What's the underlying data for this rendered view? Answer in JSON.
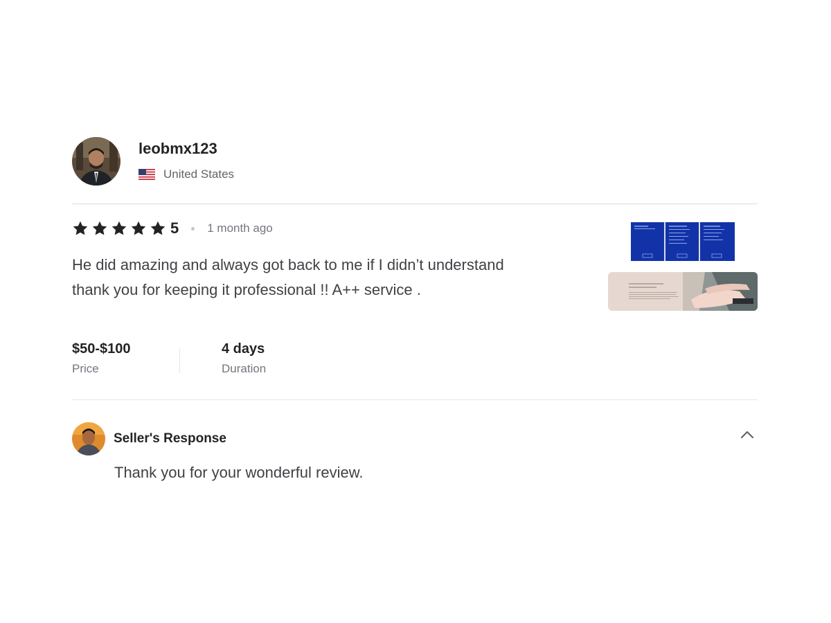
{
  "reviewer": {
    "username": "leobmx123",
    "country": "United States",
    "avatar_icon": "user-photo-avatar",
    "flag_icon": "us-flag-icon"
  },
  "review": {
    "rating": "5",
    "rating_stars": 5,
    "time_ago": "1 month ago",
    "text": "He did amazing and always got back to me if I didn’t understand thank you for keeping it professional !! A++ service .",
    "price": {
      "value": "$50-$100",
      "label": "Price"
    },
    "duration": {
      "value": "4 days",
      "label": "Duration"
    },
    "star_color": "#222325"
  },
  "seller_response": {
    "title": "Seller's Response",
    "text": "Thank you for your wonderful review.",
    "collapse_icon": "chevron-up-icon"
  }
}
